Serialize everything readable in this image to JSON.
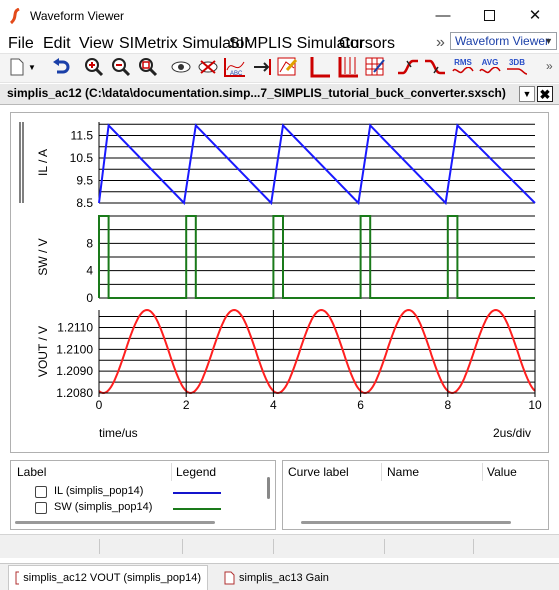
{
  "window": {
    "title": "Waveform Viewer"
  },
  "menu": {
    "items": [
      "File",
      "Edit",
      "View",
      "SIMetrix Simulator",
      "SIMPLIS Simulator",
      "Cursors"
    ],
    "overflow": "»",
    "combo_value": "Waveform Viewer"
  },
  "toolbar": {
    "overflow": "»",
    "icons": [
      "new-icon",
      "dropdown-icon",
      "undo-icon",
      "zoom-in-icon",
      "zoom-out-icon",
      "zoom-fit-icon",
      "view-icon",
      "hide-curve-icon",
      "measure-abc-icon",
      "cursor-arrow-icon",
      "add-curve-icon",
      "axis-icon",
      "grid-icon",
      "grid-scale-icon",
      "rise-icon",
      "fall-icon",
      "rms-icon",
      "avg-icon",
      "3db-icon"
    ],
    "rms_label": "RMS",
    "avg_label": "AVG",
    "db_label": "3DB"
  },
  "document_tab": {
    "title": "simplis_ac12 (C:\\data\\documentation.simp...7_SIMPLIS_tutorial_buck_converter.sxsch)"
  },
  "chart_data": [
    {
      "type": "line",
      "ylabel": "IL / A",
      "yticks": [
        "11.5",
        "10.5",
        "9.5",
        "8.5"
      ],
      "ylim": [
        8.5,
        12.1
      ],
      "series": [
        {
          "name": "IL (simplis_pop14)",
          "color": "#1a1aff",
          "points": [
            [
              0,
              8.5
            ],
            [
              0.22,
              11.95
            ],
            [
              1.95,
              8.5
            ],
            [
              2.22,
              11.95
            ],
            [
              3.95,
              8.5
            ],
            [
              4.22,
              11.95
            ],
            [
              5.95,
              8.5
            ],
            [
              6.22,
              11.95
            ],
            [
              7.95,
              8.5
            ],
            [
              8.22,
              11.95
            ],
            [
              10,
              8.5
            ]
          ]
        }
      ]
    },
    {
      "type": "line",
      "ylabel": "SW / V",
      "yticks": [
        "8",
        "4",
        "0"
      ],
      "ylim": [
        0,
        12
      ],
      "series": [
        {
          "name": "SW (simplis_pop14)",
          "color": "#1a7a1a",
          "pulses": [
            [
              0,
              0.22
            ],
            [
              2.0,
              2.22
            ],
            [
              4.0,
              4.22
            ],
            [
              6.0,
              6.22
            ],
            [
              8.0,
              8.22
            ]
          ],
          "high": 12,
          "low": 0
        }
      ]
    },
    {
      "type": "line",
      "ylabel": "VOUT / V",
      "yticks": [
        "1.2110",
        "1.2100",
        "1.2090",
        "1.2080"
      ],
      "ylim": [
        1.208,
        1.2118
      ],
      "series": [
        {
          "name": "VOUT (simplis_pop14)",
          "color": "#ff2020",
          "period": 2,
          "min": 1.208,
          "max": 1.2118,
          "phase": 0.1
        }
      ]
    }
  ],
  "x_axis": {
    "ticks": [
      "0",
      "2",
      "4",
      "6",
      "8",
      "10"
    ],
    "xlim": [
      0,
      10
    ],
    "label": "time/us",
    "scale": "2us/div"
  },
  "legend_panel": {
    "headers": [
      "Label",
      "Legend"
    ],
    "rows": [
      {
        "label": "IL (simplis_pop14)",
        "color": "#1414cc"
      },
      {
        "label": "SW (simplis_pop14)",
        "color": "#1a7a1a"
      }
    ]
  },
  "cursor_panel": {
    "headers": [
      "Curve label",
      "Name",
      "Value"
    ]
  },
  "bottom_tabs": [
    {
      "label": "simplis_ac12 VOUT (simplis_pop14)",
      "active": true
    },
    {
      "label": "simplis_ac13 Gain",
      "active": false
    }
  ]
}
